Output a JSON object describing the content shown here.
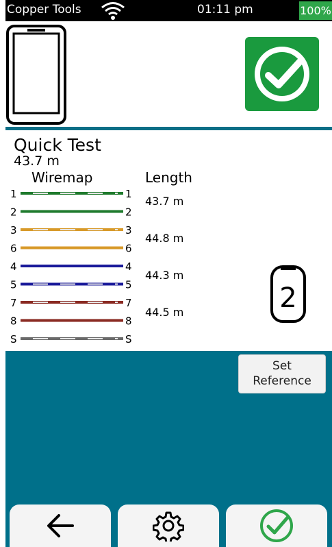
{
  "status": {
    "app_name": "Copper Tools",
    "time": "01:11 pm",
    "battery": "100%",
    "battery_color": "#2fa64a"
  },
  "header": {
    "device_icon": "tester-device-icon",
    "result_icon": "check-circle-icon",
    "result_color": "#1a9a3e"
  },
  "test": {
    "title": "Quick Test",
    "length": "43.7 m",
    "wiremap_header": "Wiremap",
    "length_header": "Length",
    "pair_lengths": [
      "43.7 m",
      "44.8 m",
      "44.3 m",
      "44.5 m"
    ],
    "wires": [
      {
        "left": "1",
        "right": "1",
        "color": "#1e7a2c",
        "striped": true
      },
      {
        "left": "2",
        "right": "2",
        "color": "#1e7a2c",
        "striped": false
      },
      {
        "left": "3",
        "right": "3",
        "color": "#d89a2a",
        "striped": true
      },
      {
        "left": "6",
        "right": "6",
        "color": "#d89a2a",
        "striped": false
      },
      {
        "left": "4",
        "right": "4",
        "color": "#1a1a9a",
        "striped": false
      },
      {
        "left": "5",
        "right": "5",
        "color": "#1a1a9a",
        "striped": true
      },
      {
        "left": "7",
        "right": "7",
        "color": "#8a2a22",
        "striped": true
      },
      {
        "left": "8",
        "right": "8",
        "color": "#8a2a22",
        "striped": false
      },
      {
        "left": "S",
        "right": "S",
        "color": "#6a6a6a",
        "striped": true
      }
    ],
    "remote_id": "2"
  },
  "actions": {
    "set_reference": "Set\nReference"
  },
  "nav": {
    "back_icon": "back-arrow-icon",
    "settings_icon": "gear-icon",
    "done_icon": "check-icon",
    "done_color": "#2fa64a"
  },
  "panel_color": "#00708a"
}
